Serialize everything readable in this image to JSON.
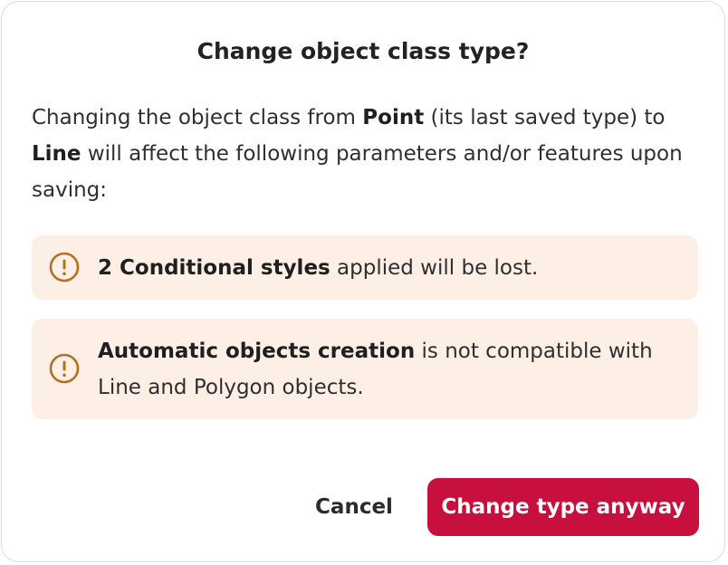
{
  "dialog": {
    "title": "Change object class type?",
    "message": {
      "part1": "Changing the object class from ",
      "from_type": "Point",
      "part2": " (its last saved type) to ",
      "to_type": "Line",
      "part3": " will affect the following parameters and/or features upon saving:"
    },
    "warnings": [
      {
        "icon": "exclamation-circle-icon",
        "emphasis": "2 Conditional styles",
        "text": " applied will be lost."
      },
      {
        "icon": "exclamation-circle-icon",
        "emphasis": "Automatic objects creation",
        "text": " is not compatible with Line and Polygon objects."
      }
    ],
    "buttons": {
      "cancel_label": "Cancel",
      "confirm_label": "Change type anyway"
    }
  },
  "colors": {
    "warning_background": "#fdefe6",
    "warning_icon": "#b5711c",
    "primary_button": "#c8103f",
    "border": "#dcdcdc"
  }
}
